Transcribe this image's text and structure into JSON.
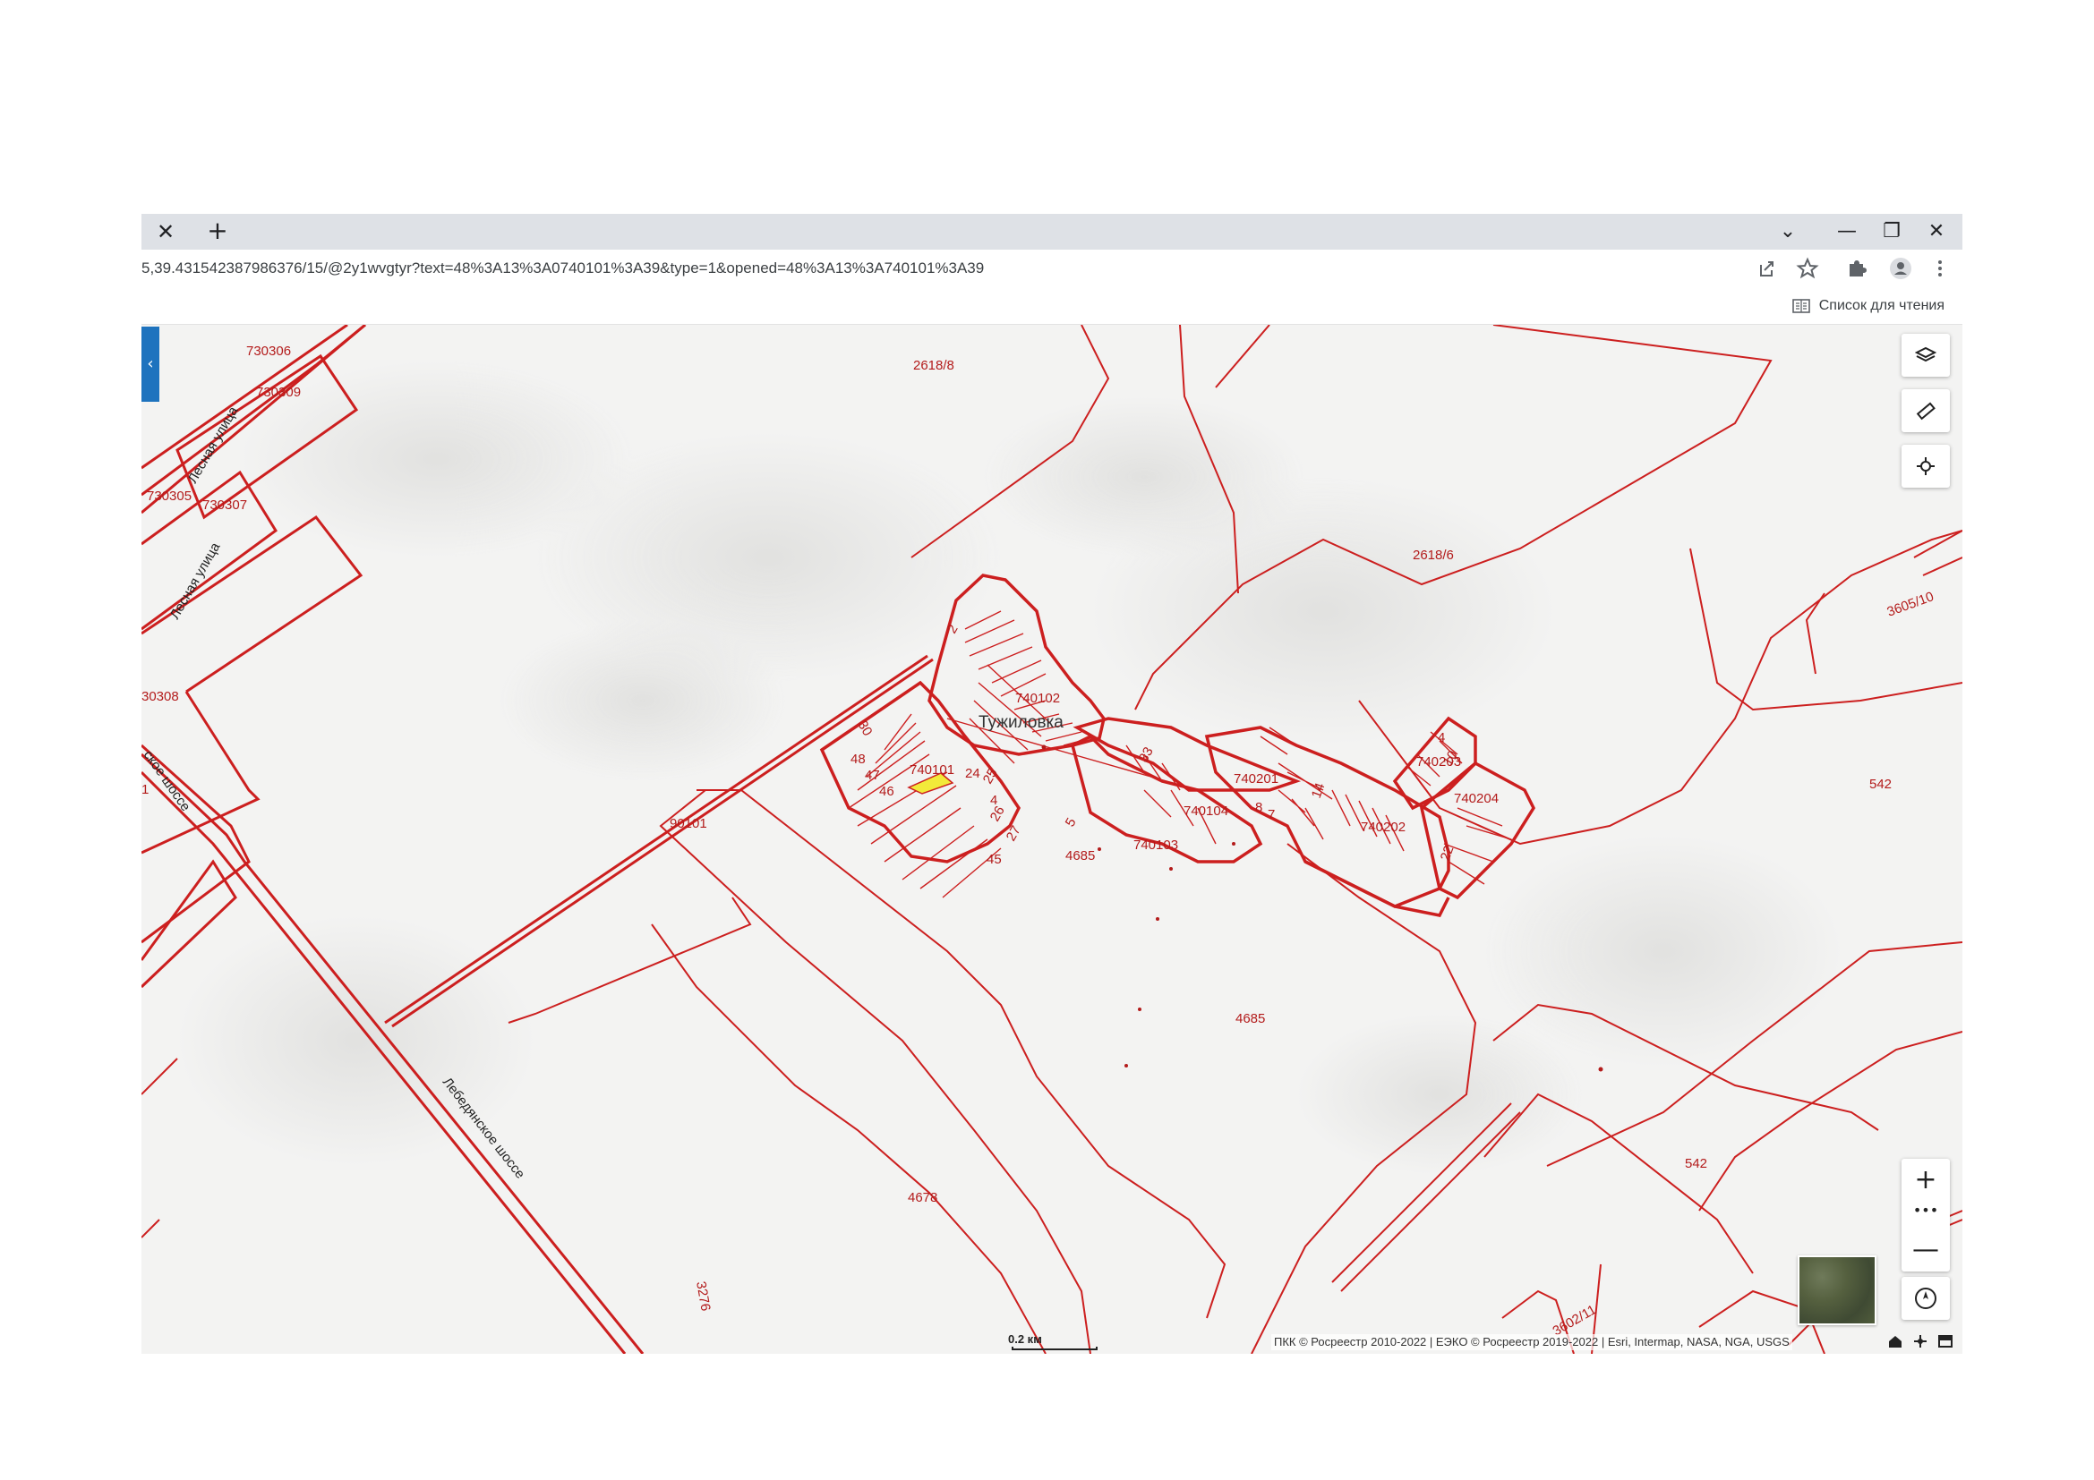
{
  "browser": {
    "tab_close_icon": "close-icon",
    "new_tab_label": "+",
    "window_controls": {
      "tab_search": "⌄",
      "minimize": "—",
      "restore": "❐",
      "close": "✕"
    },
    "url": "5,39.431542387986376/15/@2y1wvgtyr?text=48%3A13%3A0740101%3A39&type=1&opened=48%3A13%3A740101%3A39",
    "toolbar_icons": [
      "share-icon",
      "star-icon",
      "extensions-icon",
      "profile-icon",
      "kebab-menu-icon"
    ],
    "reading_list_label": "Список для чтения"
  },
  "map": {
    "side_panel_toggle": "‹",
    "tools": [
      "layers-icon",
      "ruler-icon",
      "locate-icon"
    ],
    "zoom_in": "+",
    "zoom_more": "•••",
    "zoom_out": "—",
    "compass_icon": "compass-icon",
    "scale": "0.2 км",
    "attribution": "ПКК © Росреестр 2010-2022 | ЕЭКО © Росреестр 2019-2022 | Esri, Intermap, NASA, NGA, USGS",
    "place_name": "Тужиловка",
    "streets": {
      "lesnaya_1": "Лесная улица",
      "lesnaya_2": "Лесная улица",
      "lebedyanskoe": "Лебедянское шоссе",
      "shosse_left": "ское шоссе"
    },
    "quarter_labels": {
      "q730306": "730306",
      "q730309": "730309",
      "q730305": "730305",
      "q730307": "730307",
      "q30308": "30308",
      "q2618_8": "2618/8",
      "q2618_6": "2618/6",
      "q3605_10": "3605/10",
      "q740102": "740102",
      "q740101": "740101",
      "q740104": "740104",
      "q740103": "740103",
      "q740201": "740201",
      "q740202": "740202",
      "q740203": "740203",
      "q740204": "740204",
      "q90101": "90101",
      "q4685_a": "4685",
      "q4685_b": "4685",
      "q4678": "4678",
      "q542_a": "542",
      "q542_b": "542",
      "q3276": "3276",
      "q3602_11": "3602/11",
      "q1": "1"
    },
    "parcel_numbers": {
      "p30": "30",
      "p48": "48",
      "p47": "47",
      "p46": "46",
      "p24": "24",
      "p25": "25",
      "p4": "4",
      "p26": "26",
      "p27": "27",
      "p45": "45",
      "p33": "33",
      "p5": "5",
      "p8": "8",
      "p7": "7",
      "p14": "14",
      "p4b": "4",
      "p10": "10",
      "p22": "22",
      "p2": "2"
    },
    "colors": {
      "boundary": "#cc1f1f",
      "highlight_parcel": "#f2ea3a",
      "side_panel": "#1e73be"
    }
  }
}
